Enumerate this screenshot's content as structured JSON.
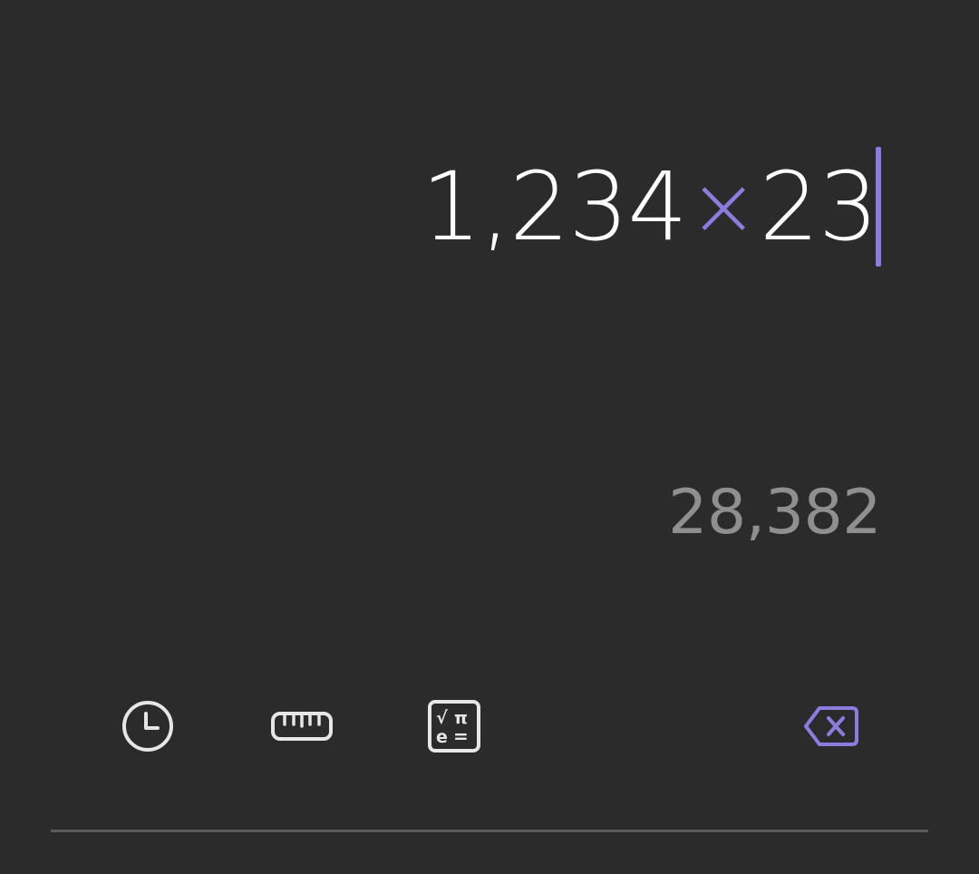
{
  "display": {
    "expression": {
      "operand_1": "1,234",
      "operator": "×",
      "operand_2": "23"
    },
    "result_preview": "28,382"
  },
  "toolbar": {
    "history_icon": "history-clock-icon",
    "units_icon": "ruler-unit-converter-icon",
    "scientific_icon": "scientific-mode-icon",
    "scientific_glyphs": {
      "root": "√",
      "pi": "π",
      "e": "e",
      "equals": "="
    },
    "backspace_icon": "backspace-icon"
  },
  "colors": {
    "background": "#2b2b2b",
    "text_primary": "#ffffff",
    "text_secondary": "#8f8f8f",
    "accent": "#8b7ce0",
    "icon_default": "#e6e6e6",
    "divider": "#5c5c5c"
  }
}
